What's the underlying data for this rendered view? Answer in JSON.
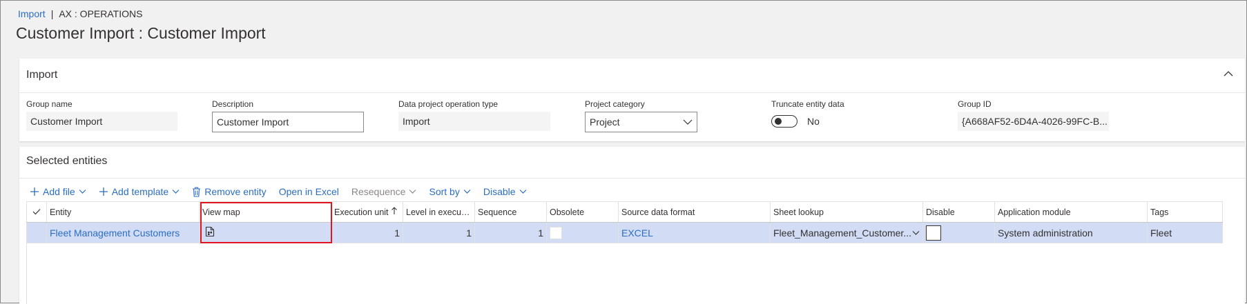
{
  "breadcrumb": {
    "link": "Import",
    "current": "AX : OPERATIONS"
  },
  "page_title": "Customer Import : Customer Import",
  "import_section": {
    "title": "Import",
    "fields": {
      "group_name": {
        "label": "Group name",
        "value": "Customer Import"
      },
      "description": {
        "label": "Description",
        "value": "Customer Import"
      },
      "operation_type": {
        "label": "Data project operation type",
        "value": "Import"
      },
      "project_category": {
        "label": "Project category",
        "value": "Project"
      },
      "truncate": {
        "label": "Truncate entity data",
        "value": "No"
      },
      "group_id": {
        "label": "Group ID",
        "value": "{A668AF52-6D4A-4026-99FC-B..."
      }
    }
  },
  "entities_section": {
    "title": "Selected entities",
    "toolbar": {
      "add_file": "Add file",
      "add_template": "Add template",
      "remove_entity": "Remove entity",
      "open_in_excel": "Open in Excel",
      "resequence": "Resequence",
      "sort_by": "Sort by",
      "disable": "Disable"
    },
    "columns": [
      "Entity",
      "View map",
      "Execution unit",
      "Level in executi...",
      "Sequence",
      "Obsolete",
      "Source data format",
      "Sheet lookup",
      "Disable",
      "Application module",
      "Tags"
    ],
    "rows": [
      {
        "entity": "Fleet Management Customers",
        "execution_unit": "1",
        "level": "1",
        "sequence": "1",
        "source_format": "EXCEL",
        "sheet_lookup": "Fleet_Management_Customer...",
        "application_module": "System administration",
        "tags": "Fleet"
      }
    ]
  },
  "colors": {
    "accent": "#2b6dc2",
    "selected_row": "#d2ddf5",
    "highlight": "#e0131f"
  }
}
